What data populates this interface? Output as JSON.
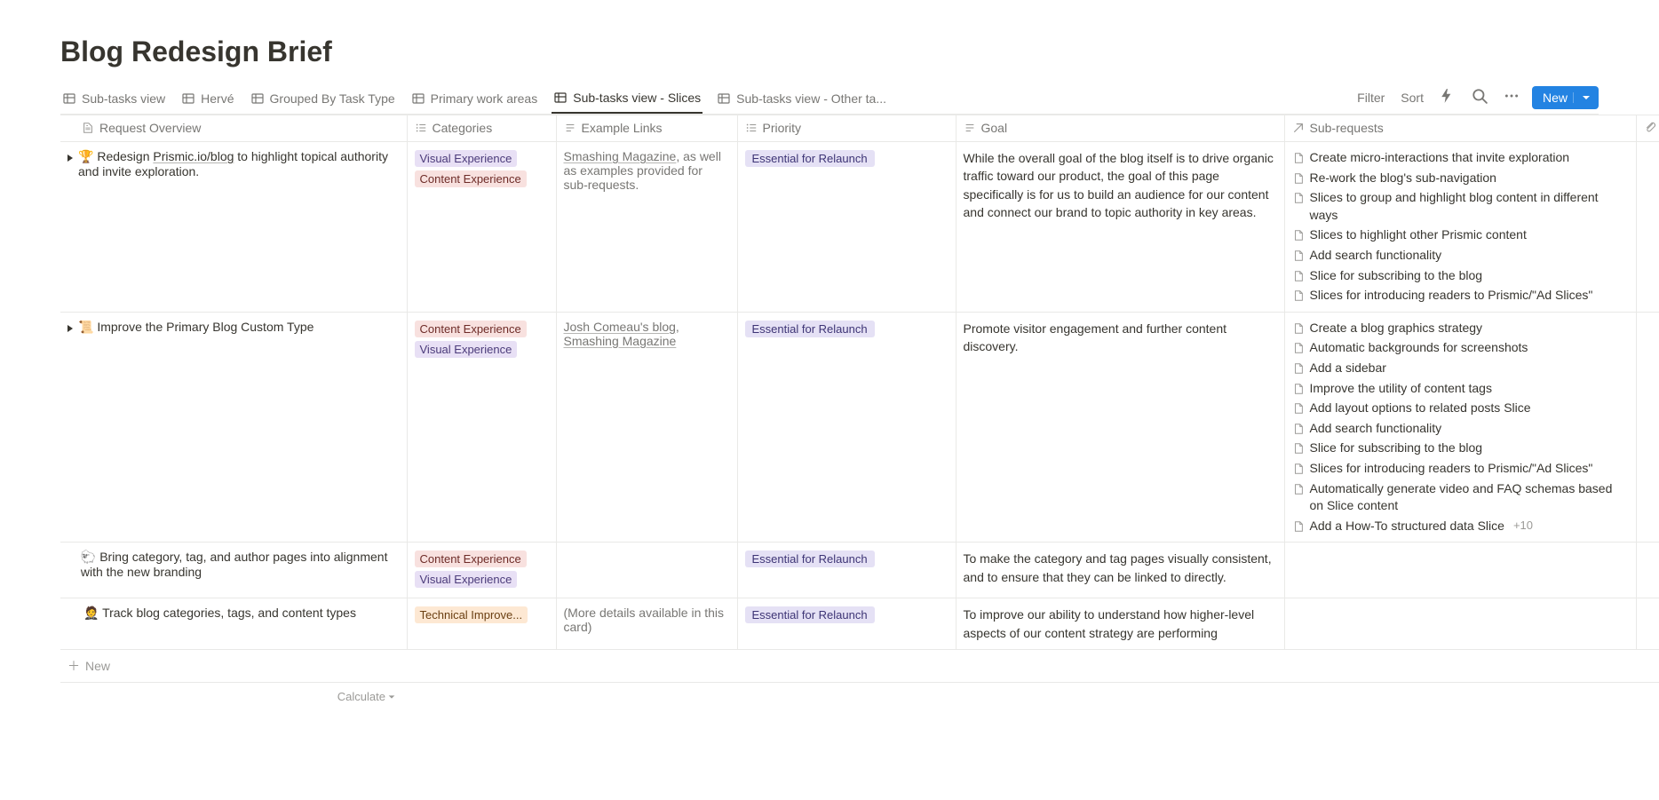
{
  "page": {
    "title": "Blog Redesign Brief"
  },
  "tabs": {
    "items": [
      {
        "label": "Sub-tasks view"
      },
      {
        "label": "Hervé"
      },
      {
        "label": "Grouped By Task Type"
      },
      {
        "label": "Primary work areas"
      },
      {
        "label": "Sub-tasks view - Slices"
      },
      {
        "label": "Sub-tasks view - Other ta..."
      }
    ],
    "active_index": 4
  },
  "toolbar": {
    "filter": "Filter",
    "sort": "Sort",
    "new": "New"
  },
  "columns": {
    "c1": "Request Overview",
    "c2": "Categories",
    "c3": "Example Links",
    "c4": "Priority",
    "c5": "Goal",
    "c6": "Sub-requests"
  },
  "tags": {
    "visual": "Visual Experience",
    "content": "Content Experience",
    "tech": "Technical Improve...",
    "priority": "Essential for Relaunch"
  },
  "rows": [
    {
      "emoji": "🏆",
      "title_pre": "Redesign ",
      "title_link": "Prismic.io/blog",
      "title_post": " to highlight topical authority and invite exploration.",
      "categories": [
        "visual",
        "content"
      ],
      "links_html": "<span class='u'>Smashing Magazine</span>, as well as examples provided for sub-requests.",
      "priority": true,
      "goal": "While the overall goal of the blog itself is to drive organic traffic toward our product, the goal of this page specifically is for us to build an audience for our content and connect our brand to topic authority in key areas.",
      "subrequests": [
        "Create micro-interactions that invite exploration",
        "Re-work the blog's sub-navigation",
        "Slices to group and highlight blog content in different ways",
        "Slices to highlight other Prismic content",
        "Add search functionality",
        "Slice for subscribing to the blog",
        "Slices for introducing readers to Prismic/\"Ad Slices\""
      ],
      "more": null,
      "expandable": true
    },
    {
      "emoji": "📜",
      "title_pre": "",
      "title_link": "",
      "title_post": "Improve the Primary Blog Custom Type",
      "categories": [
        "content",
        "visual"
      ],
      "links_html": "<span class='u'>Josh Comeau's blog</span>, <span class='u'>Smashing Magazine</span>",
      "priority": true,
      "goal": "Promote visitor engagement and further content discovery.",
      "subrequests": [
        "Create a blog graphics strategy",
        "Automatic backgrounds for screenshots",
        "Add a sidebar",
        "Improve the utility of content tags",
        "Add layout options to related posts Slice",
        "Add search functionality",
        "Slice for subscribing to the blog",
        "Slices for introducing readers to Prismic/\"Ad Slices\"",
        "Automatically generate video and FAQ schemas based on Slice content",
        "Add a How-To structured data Slice"
      ],
      "more": "+10",
      "expandable": true
    },
    {
      "emoji": "🐑",
      "title_pre": "",
      "title_link": "",
      "title_post": "Bring category, tag, and author pages into alignment with the new branding",
      "categories": [
        "content",
        "visual"
      ],
      "links_html": "",
      "priority": true,
      "goal": "To make the category and tag pages visually consistent, and to ensure that they can be linked to directly.",
      "subrequests": [],
      "more": null,
      "expandable": false
    },
    {
      "emoji": "🤵",
      "title_pre": "",
      "title_link": "",
      "title_post": "Track blog categories, tags, and content types",
      "categories": [
        "tech"
      ],
      "links_html": "(More details available in this card)",
      "priority": true,
      "goal": "To improve our ability to understand how higher-level aspects of our content strategy are performing",
      "subrequests": [],
      "more": null,
      "expandable": false
    }
  ],
  "footer": {
    "new_row": "New",
    "calculate": "Calculate"
  }
}
